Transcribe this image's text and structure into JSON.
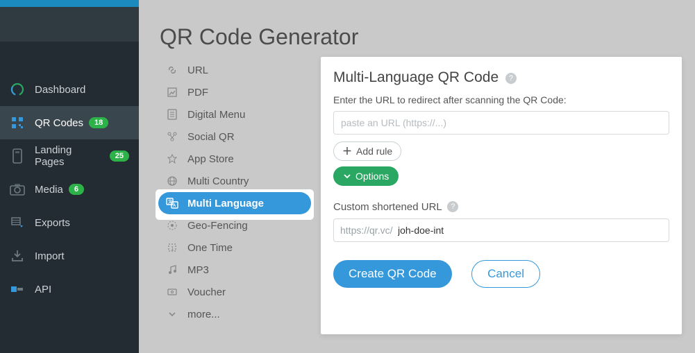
{
  "sidebar": {
    "items": [
      {
        "label": "Dashboard",
        "badge": null
      },
      {
        "label": "QR Codes",
        "badge": "18"
      },
      {
        "label": "Landing Pages",
        "badge": "25"
      },
      {
        "label": "Media",
        "badge": "6"
      },
      {
        "label": "Exports",
        "badge": null
      },
      {
        "label": "Import",
        "badge": null
      },
      {
        "label": "API",
        "badge": null
      }
    ]
  },
  "page": {
    "title": "QR Code Generator"
  },
  "types": [
    "URL",
    "PDF",
    "Digital Menu",
    "Social QR",
    "App Store",
    "Multi Country",
    "Multi Language",
    "Geo-Fencing",
    "One Time",
    "MP3",
    "Voucher",
    "more..."
  ],
  "panel": {
    "title": "Multi-Language QR Code",
    "subtitle": "Enter the URL to redirect after scanning the QR Code:",
    "url_placeholder": "paste an URL (https://...)",
    "add_rule": "Add rule",
    "options": "Options",
    "short_label": "Custom shortened URL",
    "short_prefix": "https://qr.vc/",
    "short_value": "joh-doe-int",
    "create": "Create QR Code",
    "cancel": "Cancel"
  }
}
